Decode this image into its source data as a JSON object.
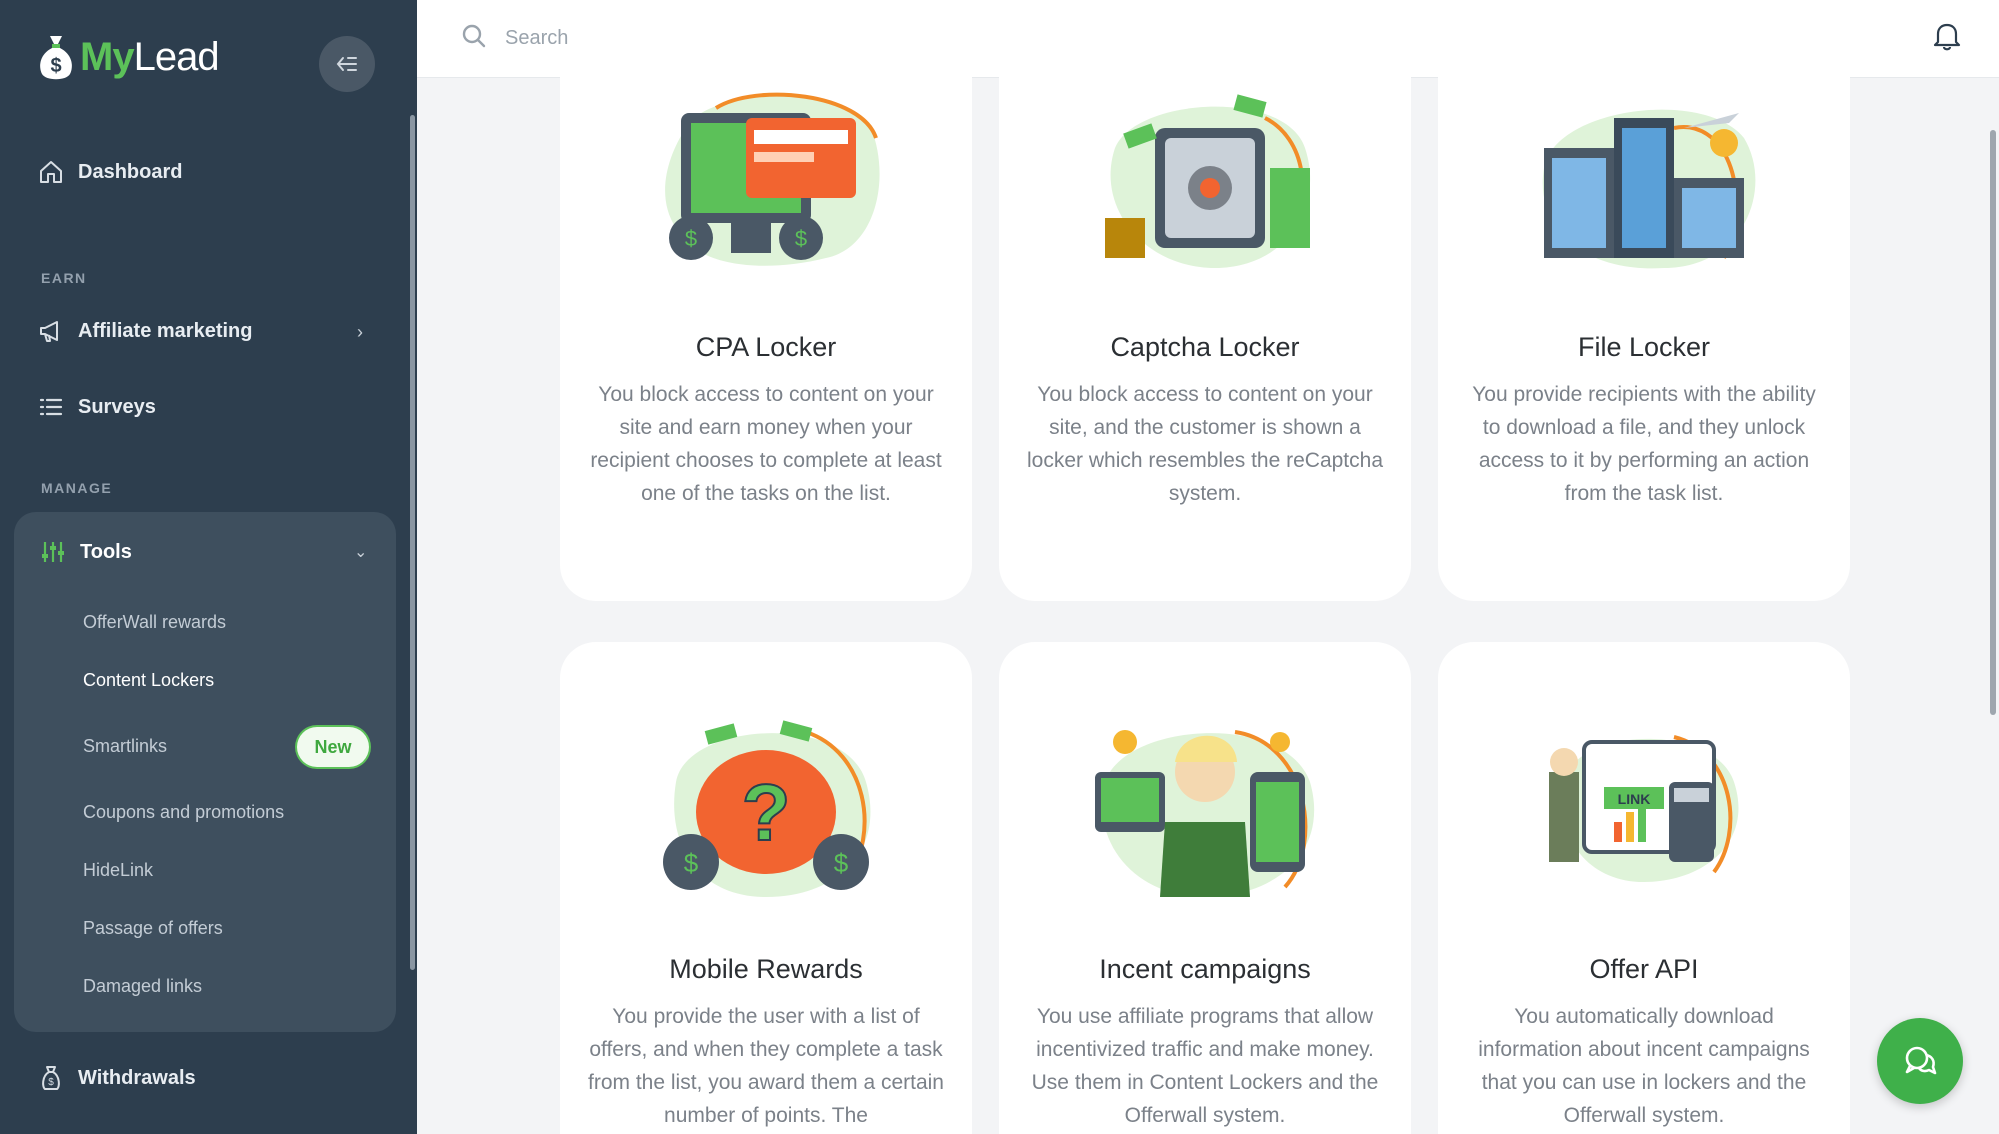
{
  "brand": {
    "my": "My",
    "lead": "Lead"
  },
  "search": {
    "placeholder": "Search"
  },
  "sidebar": {
    "dashboard": "Dashboard",
    "section_earn": "EARN",
    "affiliate": "Affiliate marketing",
    "surveys": "Surveys",
    "section_manage": "MANAGE",
    "tools": "Tools",
    "sub": [
      "OfferWall rewards",
      "Content Lockers",
      "Smartlinks",
      "Coupons and promotions",
      "HideLink",
      "Passage of offers",
      "Damaged links"
    ],
    "new_badge": "New",
    "withdrawals": "Withdrawals"
  },
  "cards": [
    {
      "title": "CPA Locker",
      "desc": "You block access to content on your site and earn money when your recipient chooses to complete at least one of the tasks on the list."
    },
    {
      "title": "Captcha Locker",
      "desc": "You block access to content on your site, and the customer is shown a locker which resembles the reCaptcha system."
    },
    {
      "title": "File Locker",
      "desc": "You provide recipients with the ability to download a file, and they unlock access to it by performing an action from the task list."
    },
    {
      "title": "Mobile Rewards",
      "desc": "You provide the user with a list of offers, and when they complete a task from the list, you award them a certain number of points. The"
    },
    {
      "title": "Incent campaigns",
      "desc": "You use affiliate programs that allow incentivized traffic and make money. Use them in Content Lockers and the Offerwall system."
    },
    {
      "title": "Offer API",
      "desc": "You automatically download information about incent campaigns that you can use in lockers and the Offerwall system."
    }
  ],
  "colors": {
    "sidebar": "#2d3e4e",
    "accent": "#5cc159",
    "tools_bg": "#3e4f5e",
    "fab": "#3fb04a"
  },
  "icons": [
    "money-bag-icon",
    "collapse-icon",
    "home-icon",
    "megaphone-icon",
    "list-icon",
    "sliders-icon",
    "chevron-right-icon",
    "chevron-down-icon",
    "withdrawal-icon",
    "search-icon",
    "bell-icon",
    "chat-icon"
  ]
}
